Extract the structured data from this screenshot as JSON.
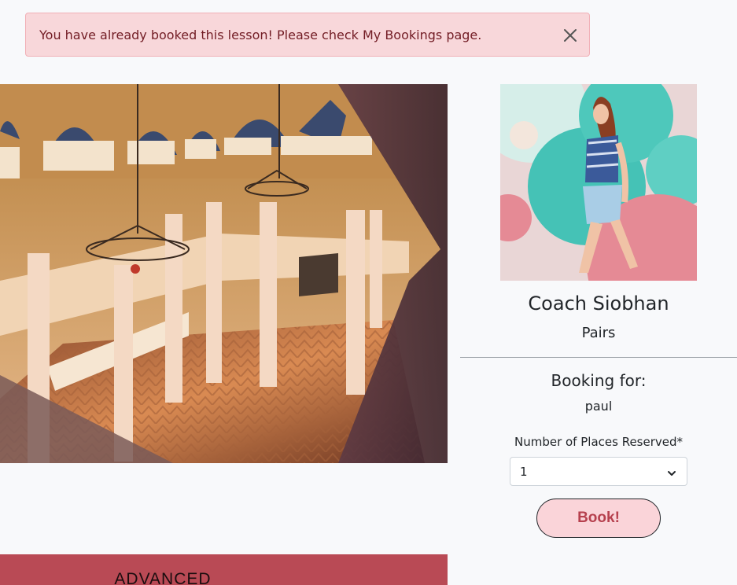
{
  "alert": {
    "message": "You have already booked this lesson! Please check My Bookings page.",
    "close_icon": "close-icon",
    "background": "#f8d7da",
    "text_color": "#721c24"
  },
  "coach": {
    "name": "Coach Siobhan",
    "style": "Pairs"
  },
  "booking": {
    "heading": "Booking for:",
    "user": "paul",
    "places_label": "Number of Places Reserved*",
    "places_value": "1",
    "submit_label": "Book!"
  },
  "lesson": {
    "level": "ADVANCED",
    "level_color": "#b94a55"
  },
  "colors": {
    "accent": "#b6404e",
    "button_bg": "#fad4d9"
  }
}
